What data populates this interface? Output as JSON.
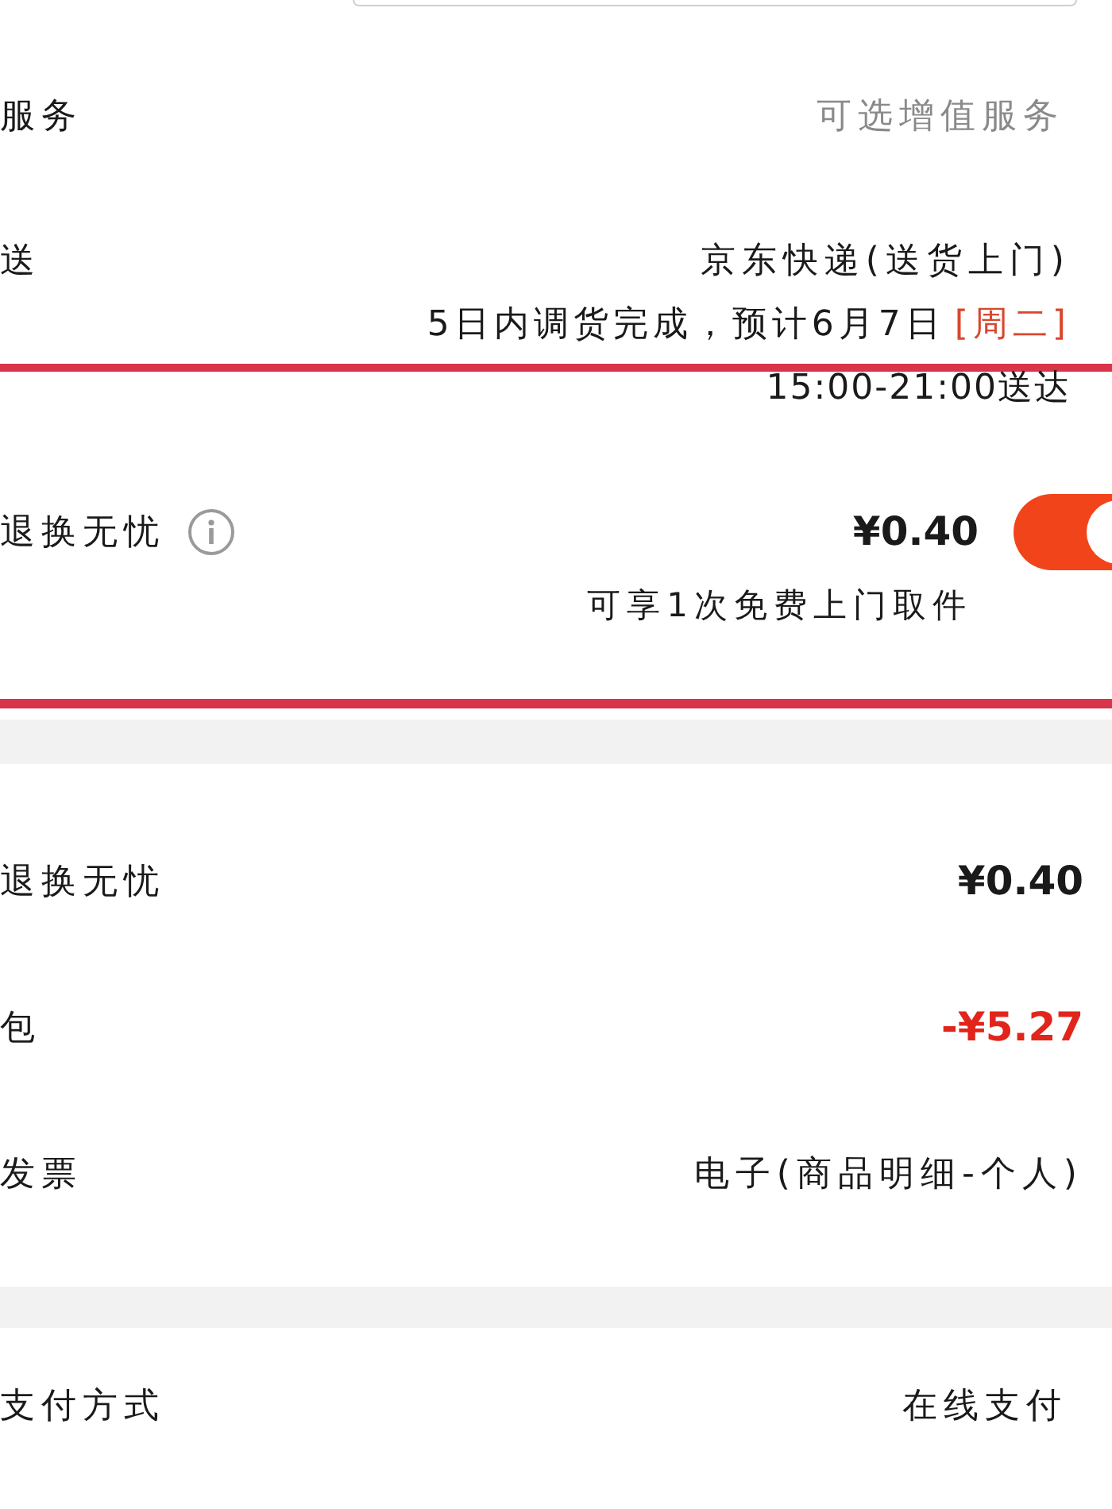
{
  "services": {
    "label": "服务",
    "value": "可选增值服务"
  },
  "delivery": {
    "label": "送",
    "method": "京东快递(送货上门)",
    "estimate": "5日内调货完成，预计6月7日",
    "weekday": "[周二]",
    "time_window": "15:00-21:00送达"
  },
  "return_service": {
    "label": "退换无忧",
    "price": "¥0.40",
    "on": true,
    "note": "可享1次免费上门取件"
  },
  "summary": [
    {
      "label": "退换无忧",
      "value": "¥0.40",
      "kind": "charge"
    },
    {
      "label": "包",
      "value": "-¥5.27",
      "kind": "discount"
    },
    {
      "label": "发票",
      "value": "电子(商品明细-个人)",
      "kind": "text"
    }
  ],
  "payment": {
    "label": "支付方式",
    "value": "在线支付"
  }
}
